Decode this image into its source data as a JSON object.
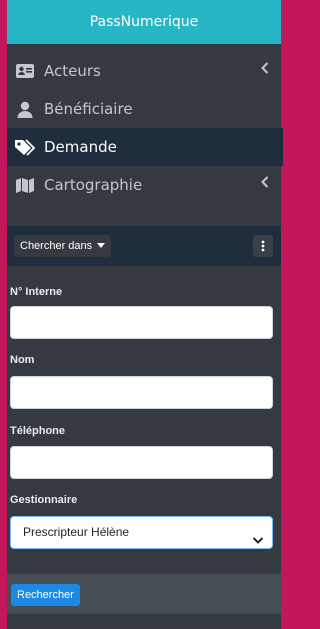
{
  "app": {
    "title": "PassNumerique"
  },
  "sidebar": {
    "items": [
      {
        "label": "Acteurs",
        "icon": "id-card-icon",
        "has_submenu": true,
        "active": false
      },
      {
        "label": "Bénéficiaire",
        "icon": "user-icon",
        "has_submenu": false,
        "active": false
      },
      {
        "label": "Demande",
        "icon": "tags-icon",
        "has_submenu": false,
        "active": true
      },
      {
        "label": "Cartographie",
        "icon": "map-icon",
        "has_submenu": true,
        "active": false
      }
    ]
  },
  "filter": {
    "search_in_label": "Chercher dans",
    "kebab_icon": "ellipsis-vertical-icon"
  },
  "form": {
    "fields": [
      {
        "label": "N° Interne",
        "value": ""
      },
      {
        "label": "Nom",
        "value": ""
      },
      {
        "label": "Téléphone",
        "value": ""
      }
    ],
    "gestionnaire": {
      "label": "Gestionnaire",
      "selected": "Prescripteur Hélène"
    },
    "submit_label": "Rechercher"
  },
  "colors": {
    "brand": "#26b6c6",
    "sidebar_bg": "#343a40",
    "active_bg": "#1f2d3d",
    "outer": "#c2185b",
    "primary": "#1e88e5"
  }
}
